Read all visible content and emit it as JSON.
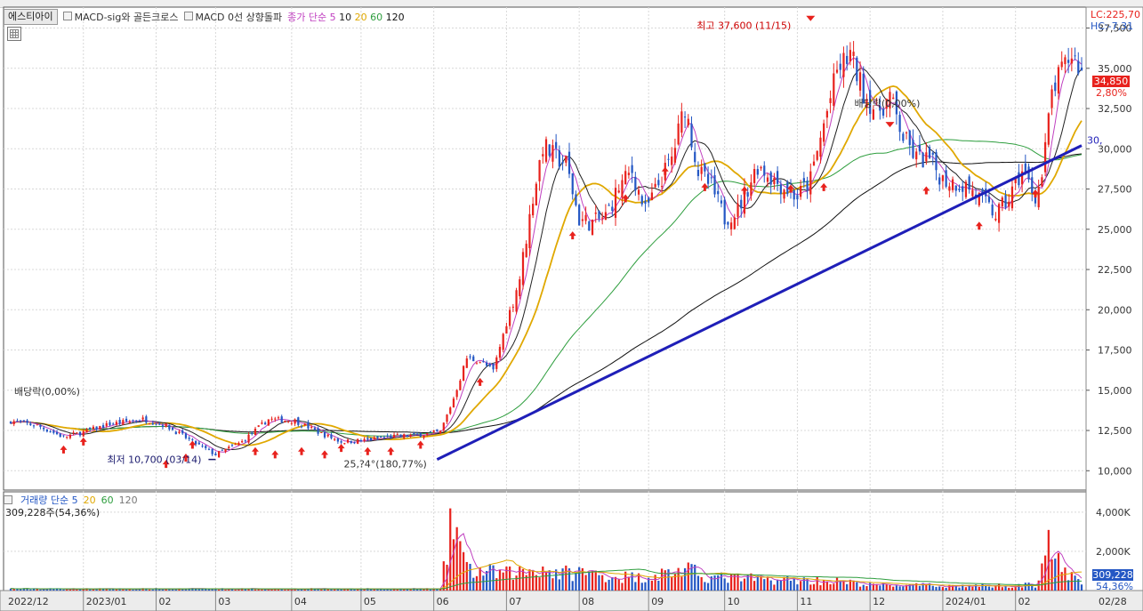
{
  "header": {
    "stock_tag": "에스티아이",
    "indicators": [
      "MACD-sig와 골든크로스",
      "MACD 0선 상향돌파"
    ],
    "ma_legend": {
      "label": "종가 단순 5",
      "periods": [
        "10",
        "20",
        "60",
        "120"
      ]
    },
    "right_lc": "LC:225,70",
    "right_hc": "HC:-7,31"
  },
  "price_badge": {
    "value": "34,850",
    "pct": "2,80%"
  },
  "volume": {
    "legend_label": "거래량 단순 5",
    "periods": [
      "20",
      "60",
      "120"
    ],
    "summary": "309,228주(54,36%)",
    "badge": "309,228",
    "badge_pct": "54,36%"
  },
  "annotations": {
    "high": "최고 37,600 (11/15)",
    "low": "최저 10,700 (03/14)",
    "div1": "배당락(0,00%)",
    "div2": "배당락(0,00%)",
    "low_pct": "25,?4°(180,77%)",
    "trend_label": "30,"
  },
  "colors": {
    "up": "#e8221d",
    "down": "#2457c4",
    "ma5": "#c040c0",
    "ma10": "#222222",
    "ma20": "#e0a800",
    "ma60": "#2e9e3e",
    "ma120": "#111111",
    "trend": "#1f1fb8",
    "accent": "#e8221d"
  },
  "chart_data": {
    "type": "candlestick",
    "x_ticks": [
      "2022/12",
      "2023/01",
      "02",
      "03",
      "04",
      "05",
      "06",
      "07",
      "08",
      "09",
      "10",
      "11",
      "12",
      "2024/01",
      "02",
      "02/28"
    ],
    "price_ticks": [
      "37,500",
      "35,000",
      "32,500",
      "30,000",
      "27,500",
      "25,000",
      "22,500",
      "20,000",
      "17,500",
      "15,000",
      "12,500",
      "10,000"
    ],
    "price_range": [
      8800,
      38800
    ],
    "volume_ticks": [
      "4,000K",
      "2,000K"
    ],
    "volume_range": [
      0,
      4400000
    ],
    "close_keypoints": [
      [
        0,
        13100
      ],
      [
        8,
        12800
      ],
      [
        16,
        12100
      ],
      [
        22,
        12400
      ],
      [
        30,
        12900
      ],
      [
        40,
        13200
      ],
      [
        47,
        12800
      ],
      [
        55,
        11800
      ],
      [
        62,
        11000
      ],
      [
        70,
        11800
      ],
      [
        78,
        13200
      ],
      [
        86,
        13100
      ],
      [
        94,
        12300
      ],
      [
        100,
        11800
      ],
      [
        108,
        11900
      ],
      [
        114,
        12100
      ],
      [
        122,
        12200
      ],
      [
        130,
        12400
      ],
      [
        134,
        14500
      ],
      [
        138,
        17000
      ],
      [
        142,
        16800
      ],
      [
        146,
        16200
      ],
      [
        150,
        19200
      ],
      [
        154,
        22000
      ],
      [
        158,
        27000
      ],
      [
        161,
        30200
      ],
      [
        164,
        29600
      ],
      [
        168,
        29100
      ],
      [
        172,
        25600
      ],
      [
        176,
        25400
      ],
      [
        180,
        25800
      ],
      [
        184,
        27600
      ],
      [
        188,
        28600
      ],
      [
        192,
        26100
      ],
      [
        196,
        27800
      ],
      [
        200,
        29400
      ],
      [
        204,
        32700
      ],
      [
        208,
        28600
      ],
      [
        212,
        27600
      ],
      [
        216,
        25700
      ],
      [
        220,
        26200
      ],
      [
        226,
        29000
      ],
      [
        232,
        27900
      ],
      [
        238,
        27000
      ],
      [
        242,
        28100
      ],
      [
        246,
        31500
      ],
      [
        250,
        34800
      ],
      [
        254,
        35900
      ],
      [
        258,
        33500
      ],
      [
        262,
        32300
      ],
      [
        266,
        33200
      ],
      [
        270,
        30700
      ],
      [
        274,
        29400
      ],
      [
        278,
        29300
      ],
      [
        282,
        28100
      ],
      [
        286,
        27900
      ],
      [
        290,
        27600
      ],
      [
        294,
        26700
      ],
      [
        298,
        25900
      ],
      [
        302,
        26900
      ],
      [
        306,
        28600
      ],
      [
        310,
        27100
      ],
      [
        312,
        28200
      ],
      [
        315,
        33500
      ],
      [
        318,
        34800
      ],
      [
        321,
        35900
      ],
      [
        324,
        34850
      ]
    ],
    "volume_keypoints": [
      [
        0,
        90000
      ],
      [
        130,
        90000
      ],
      [
        134,
        4000000
      ],
      [
        138,
        1100000
      ],
      [
        150,
        900000
      ],
      [
        158,
        1100000
      ],
      [
        161,
        1200000
      ],
      [
        166,
        900000
      ],
      [
        172,
        1000000
      ],
      [
        180,
        800000
      ],
      [
        190,
        700000
      ],
      [
        204,
        1100000
      ],
      [
        212,
        700000
      ],
      [
        230,
        600000
      ],
      [
        250,
        500000
      ],
      [
        260,
        300000
      ],
      [
        290,
        250000
      ],
      [
        310,
        300000
      ],
      [
        314,
        2900000
      ],
      [
        318,
        900000
      ],
      [
        322,
        700000
      ],
      [
        324,
        309228
      ]
    ],
    "markers_up": [
      [
        16,
        11900
      ],
      [
        22,
        12400
      ],
      [
        47,
        11000
      ],
      [
        53,
        11400
      ],
      [
        55,
        12200
      ],
      [
        74,
        11800
      ],
      [
        80,
        11600
      ],
      [
        88,
        11800
      ],
      [
        95,
        11600
      ],
      [
        100,
        12000
      ],
      [
        108,
        11800
      ],
      [
        115,
        11800
      ],
      [
        124,
        12200
      ],
      [
        142,
        16100
      ],
      [
        170,
        25200
      ],
      [
        186,
        27500
      ],
      [
        198,
        29200
      ],
      [
        210,
        28200
      ],
      [
        222,
        28000
      ],
      [
        236,
        28100
      ],
      [
        246,
        28200
      ],
      [
        277,
        28000
      ],
      [
        293,
        25800
      ],
      [
        310,
        27800
      ]
    ],
    "markers_down": [
      [
        242,
        37600
      ],
      [
        266,
        31000
      ]
    ],
    "trendline": [
      [
        129,
        10700
      ],
      [
        324,
        30200
      ]
    ],
    "high_point": {
      "x_index": 242,
      "value": 37600
    },
    "low_point": {
      "x_index": 62,
      "value": 10700
    }
  }
}
